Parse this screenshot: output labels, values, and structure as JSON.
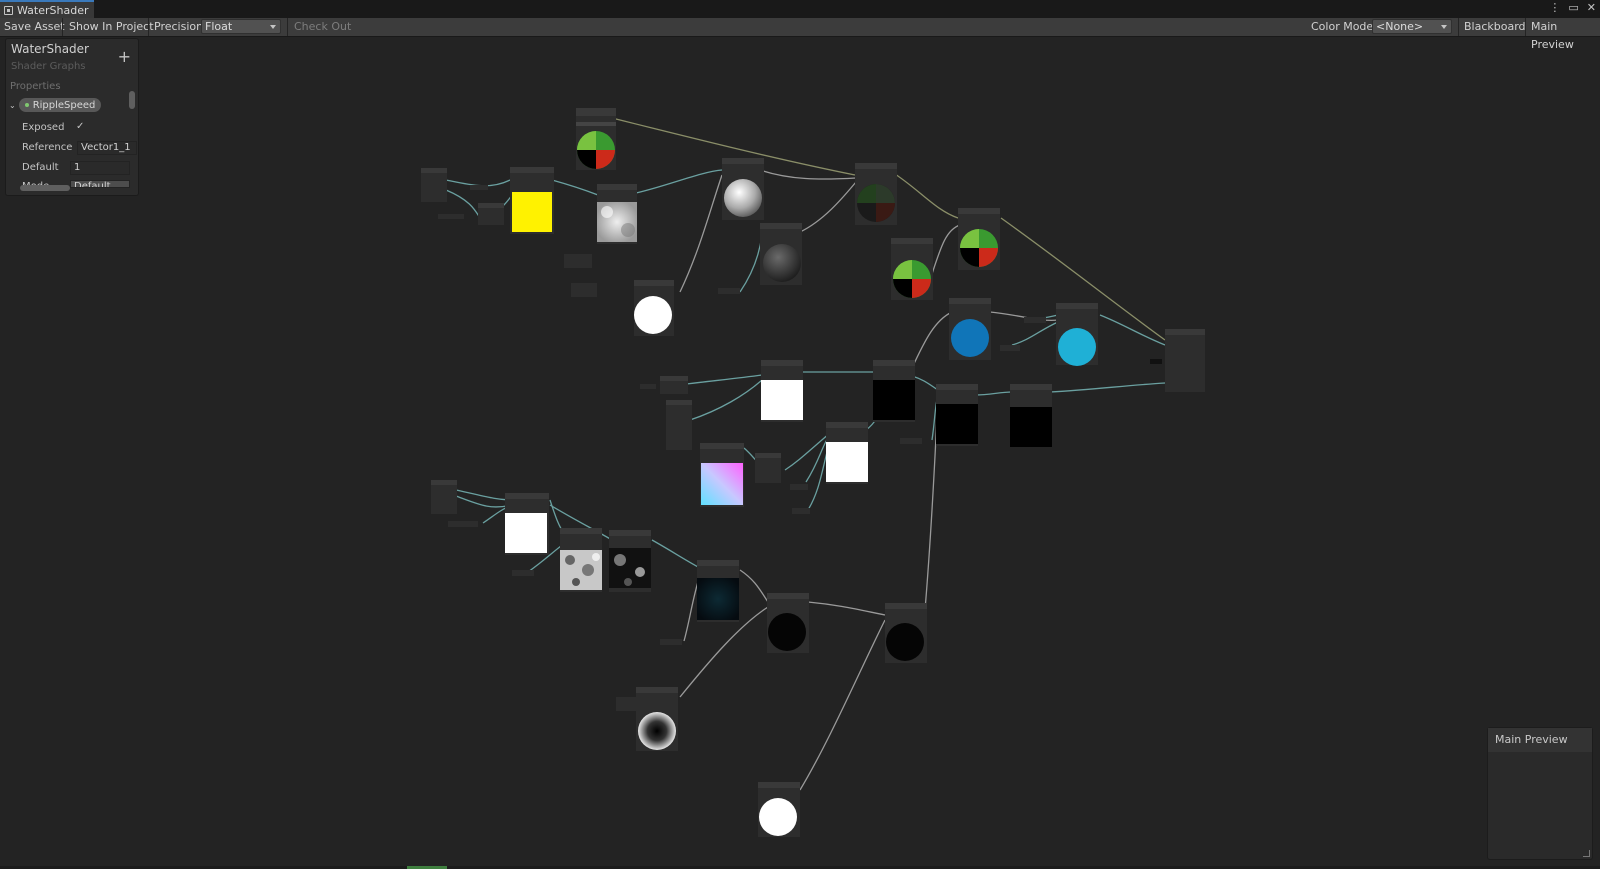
{
  "window": {
    "tab_title": "WaterShader",
    "controls": {
      "menu": "⋮",
      "maximize": "▭",
      "close": "✕"
    }
  },
  "toolbar": {
    "save_asset": "Save Asset",
    "show_in_project": "Show In Project",
    "precision_label": "Precision",
    "precision_value": "Float",
    "check_out": "Check Out",
    "color_mode_label": "Color Mode",
    "color_mode_value": "<None>",
    "blackboard": "Blackboard",
    "main_preview": "Main Preview"
  },
  "blackboard": {
    "title": "WaterShader",
    "subtitle": "Shader Graphs",
    "add_icon": "+",
    "section": "Properties",
    "property": {
      "name": "RippleSpeed",
      "exposed_label": "Exposed",
      "exposed_check": "✓",
      "reference_label": "Reference",
      "reference_value": "Vector1_1",
      "default_label": "Default",
      "default_value": "1",
      "mode_label": "Mode",
      "mode_value": "Default"
    }
  },
  "main_preview": {
    "title": "Main Preview"
  },
  "colors": {
    "yellow_preview": "#fff200",
    "blue_preview": "#1075b8",
    "cyan_preview": "#1fb0d6",
    "edge_vector": "#8a8e68",
    "edge_float": "#6aa0a0"
  }
}
